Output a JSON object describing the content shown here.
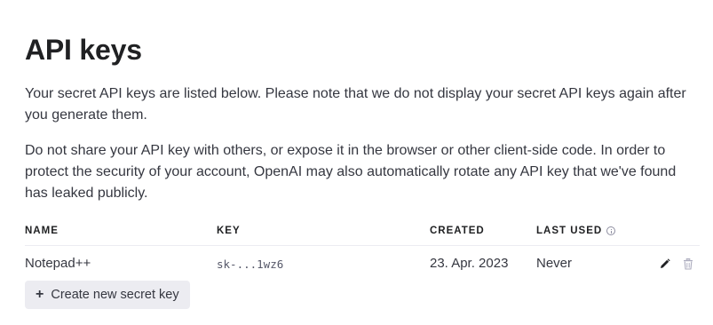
{
  "page": {
    "title": "API keys",
    "paragraph1": "Your secret API keys are listed below. Please note that we do not display your secret API keys again after you generate them.",
    "paragraph2": "Do not share your API key with others, or expose it in the browser or other client-side code. In order to protect the security of your account, OpenAI may also automatically rotate any API key that we've found has leaked publicly."
  },
  "table": {
    "columns": {
      "name": "NAME",
      "key": "KEY",
      "created": "CREATED",
      "last_used": "LAST USED"
    },
    "rows": [
      {
        "name": "Notepad++",
        "key": "sk-...1wz6",
        "created": "23. Apr. 2023",
        "last_used": "Never"
      }
    ]
  },
  "icons": {
    "last_used_info": "info-icon",
    "edit": "pencil-icon",
    "delete": "trash-icon",
    "create": "plus-icon"
  },
  "actions": {
    "plus_glyph": "+",
    "create_label": "Create new secret key"
  },
  "colors": {
    "text": "#353740",
    "heading": "#202123",
    "button_bg": "#ececf1",
    "muted_icon": "#acacbe"
  }
}
